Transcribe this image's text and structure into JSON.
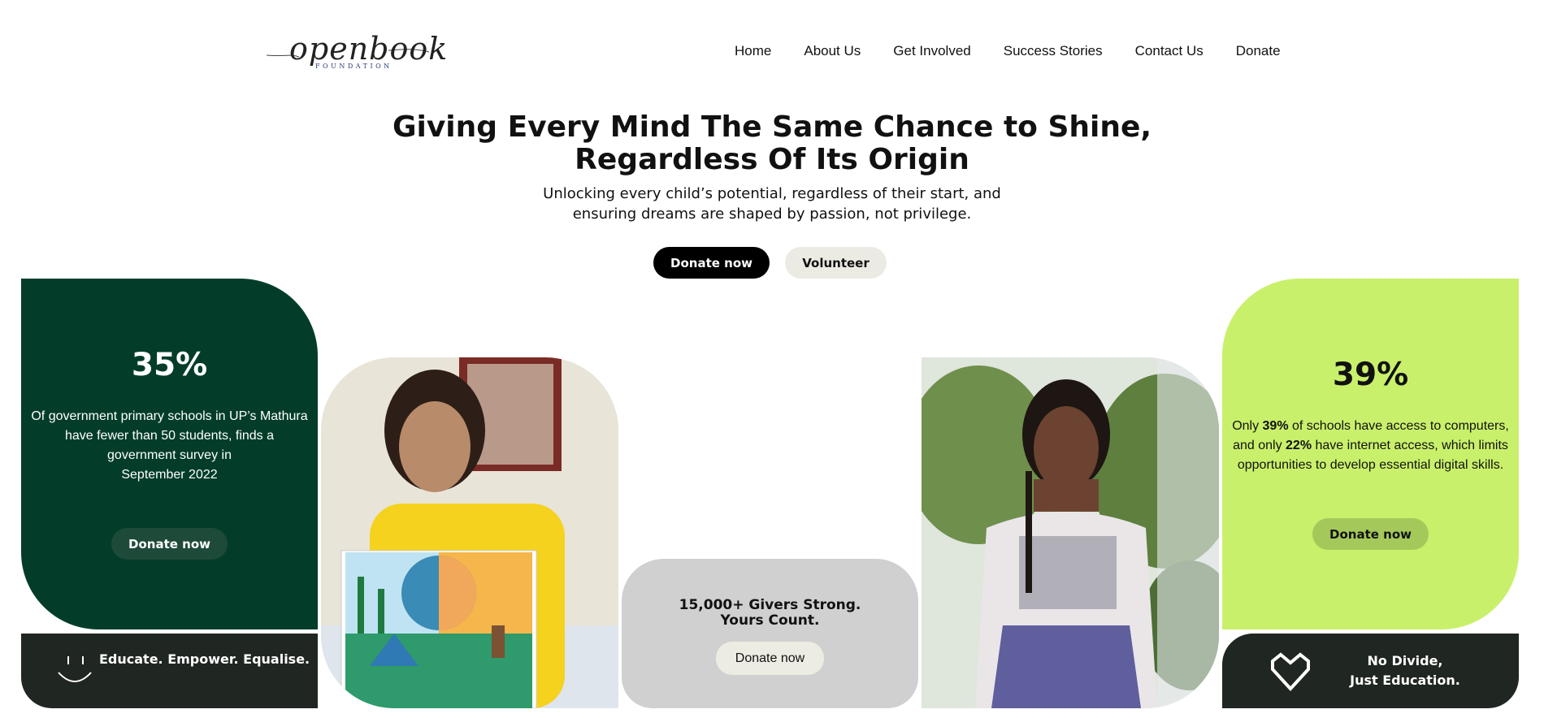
{
  "logo": {
    "wordmark": "openbook",
    "sub": "FOUNDATION",
    "icon": "openbook-logo"
  },
  "nav": {
    "items": [
      "Home",
      "About Us",
      "Get Involved",
      "Success Stories",
      "Contact Us",
      "Donate"
    ]
  },
  "hero": {
    "title_line1": "Giving Every Mind The Same Chance to Shine,",
    "title_line2": "Regardless Of Its Origin",
    "subtitle_line1": "Unlocking every child’s potential, regardless of their start, and",
    "subtitle_line2": "ensuring dreams are shaped by passion, not privilege.",
    "primary_button": "Donate now",
    "secondary_button": "Volunteer"
  },
  "stat_left": {
    "value": "35%",
    "text_lines": [
      "Of government primary schools in UP’s Mathura",
      "have fewer than 50 students, finds a",
      "government survey in",
      "September 2022"
    ],
    "button": "Donate now",
    "bg_color": "#033d2a"
  },
  "stat_right": {
    "value": "39%",
    "text_line1_pre": "Only ",
    "text_line1_bold": "39%",
    "text_line1_post": " of schools have access to computers,",
    "text_line2_pre": "and only ",
    "text_line2_bold": "22%",
    "text_line2_post": " have internet access, which limits",
    "text_line3": "opportunities to develop essential digital skills.",
    "button": "Donate now",
    "bg_color": "#c9f06b"
  },
  "givers": {
    "line1": "15,000+ Givers Strong.",
    "line2": "Yours Count.",
    "button": "Donate now"
  },
  "bar_left": {
    "text": "Educate. Empower. Equalise.",
    "icon": "smile-icon"
  },
  "bar_right": {
    "line1": "No Divide,",
    "line2": "Just Education.",
    "icon": "heart-icon"
  },
  "photos": {
    "left": "girl-with-earth-drawing-photo",
    "right": "girl-standing-photo"
  }
}
